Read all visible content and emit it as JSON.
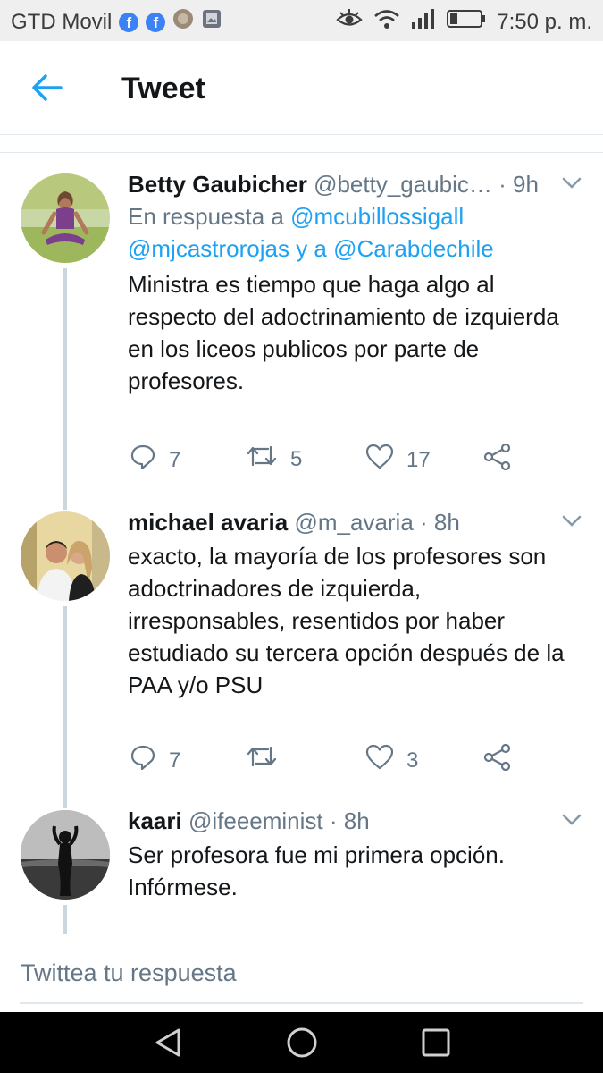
{
  "status_bar": {
    "carrier": "GTD Movil",
    "time": "7:50 p. m."
  },
  "app_bar": {
    "title": "Tweet"
  },
  "tweets": [
    {
      "name": "Betty Gaubicher",
      "handle": "@betty_gaubic…",
      "time": "· 9h",
      "reply_prefix": "En respuesta a ",
      "mention1": "@mcubillossigall",
      "mention2": "@mjcastrorojas",
      "reply_join": " y a ",
      "mention3": "@Carabdechile",
      "text": "Ministra es tiempo que haga algo al respecto del adoctrinamiento de izquierda en los liceos publicos por parte de profesores.",
      "replies": "7",
      "retweets": "5",
      "likes": "17"
    },
    {
      "name": "michael avaria",
      "handle": "@m_avaria",
      "time": "· 8h",
      "text": "exacto, la mayoría de los profesores son adoctrinadores de izquierda, irresponsables, resentidos por haber estudiado su tercera opción después de la PAA y/o PSU",
      "replies": "7",
      "retweets": "",
      "likes": "3"
    },
    {
      "name": "kaari",
      "handle": "@ifeeeminist",
      "time": "· 8h",
      "text": "Ser profesora fue mi primera opción. Infórmese."
    }
  ],
  "reply_box": {
    "placeholder": "Twittea tu respuesta"
  },
  "colors": {
    "accent": "#1da1f2",
    "secondary_text": "#657786",
    "thread_line": "#ccd6dd"
  },
  "icons": [
    "back-arrow-icon",
    "chevron-down-icon",
    "reply-icon",
    "retweet-icon",
    "like-icon",
    "share-icon",
    "nav-back-icon",
    "nav-home-icon",
    "nav-recents-icon"
  ]
}
